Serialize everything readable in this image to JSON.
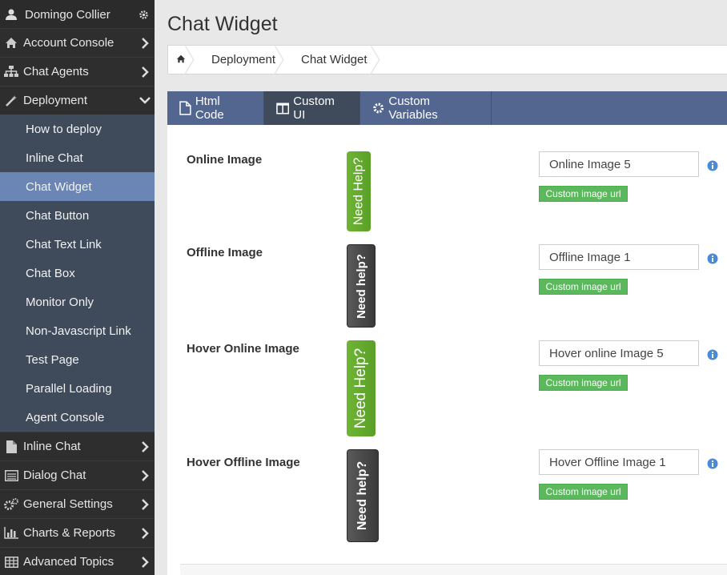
{
  "sidebar": {
    "user": {
      "name": "Domingo Collier",
      "icon": "user-icon",
      "settings_icon": "gear-icon"
    },
    "items": [
      {
        "label": "Account Console",
        "icon": "home-icon",
        "expanded": false
      },
      {
        "label": "Chat Agents",
        "icon": "sitemap-icon",
        "expanded": false
      },
      {
        "label": "Deployment",
        "icon": "magic-wand-icon",
        "expanded": true
      },
      {
        "label": "Inline Chat",
        "icon": "document-icon",
        "expanded": false
      },
      {
        "label": "Dialog Chat",
        "icon": "list-window-icon",
        "expanded": false
      },
      {
        "label": "General Settings",
        "icon": "cogs-icon",
        "expanded": false
      },
      {
        "label": "Charts & Reports",
        "icon": "bar-chart-icon",
        "expanded": false
      },
      {
        "label": "Advanced Topics",
        "icon": "table-icon",
        "expanded": false
      }
    ],
    "deployment_subitems": [
      "How to deploy",
      "Inline Chat",
      "Chat Widget",
      "Chat Button",
      "Chat Text Link",
      "Chat Box",
      "Monitor Only",
      "Non-Javascript Link",
      "Test Page",
      "Parallel Loading",
      "Agent Console"
    ],
    "active_subitem": "Chat Widget"
  },
  "main": {
    "title": "Chat Widget",
    "breadcrumb": [
      "Deployment",
      "Chat Widget"
    ],
    "tabs": [
      {
        "label": "Html Code",
        "icon": "file-icon",
        "active": false
      },
      {
        "label": "Custom UI",
        "icon": "columns-icon",
        "active": true
      },
      {
        "label": "Custom Variables",
        "icon": "gear-icon",
        "active": false
      }
    ],
    "rows": [
      {
        "label": "Online Image",
        "preview_text": "Need Help?",
        "preview_style": "green",
        "value": "Online Image 5",
        "button": "Custom image url"
      },
      {
        "label": "Offline Image",
        "preview_text": "Need help?",
        "preview_style": "dark",
        "value": "Offline Image 1",
        "button": "Custom image url"
      },
      {
        "label": "Hover Online Image",
        "preview_text": "Need Help?",
        "preview_style": "green",
        "value": "Hover online Image 5",
        "button": "Custom image url"
      },
      {
        "label": "Hover Offline Image",
        "preview_text": "Need help?",
        "preview_style": "dark",
        "value": "Hover Offline Image 1",
        "button": "Custom image url"
      }
    ]
  },
  "colors": {
    "sidebar_bg": "#2b2b2b",
    "submenu_bg": "#3f4a5b",
    "submenu_active": "#6b86b4",
    "tabbar_bg": "#52668f",
    "url_button": "#5cb85c",
    "info_icon": "#4a8bd6"
  }
}
